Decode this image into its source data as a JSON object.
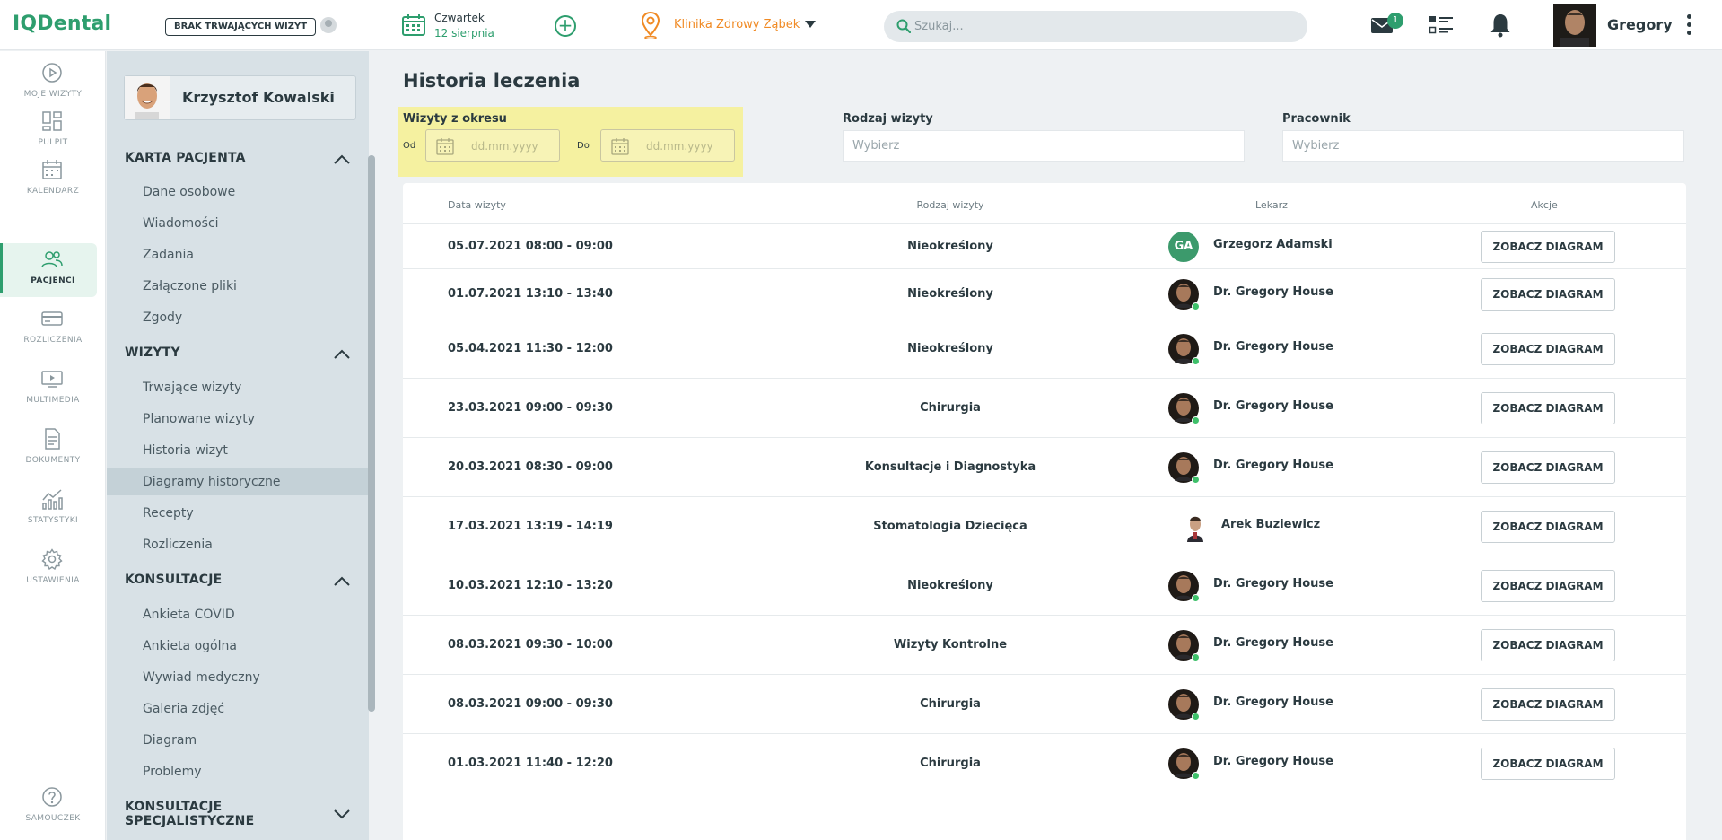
{
  "app": {
    "logo": "IQDental"
  },
  "topbar": {
    "no_visits_label": "BRAK TRWAJĄCYCH WIZYT",
    "day": "Czwartek",
    "date": "12 sierpnia",
    "clinic": "Klinika Zdrowy Ząbek",
    "search_placeholder": "Szukaj...",
    "mail_count": "1",
    "user_name": "Gregory",
    "colors": {
      "accent": "#2e9e6e",
      "clinic": "#f08a24"
    }
  },
  "rail": {
    "items": [
      {
        "label": "MOJE WIZYTY",
        "icon": "play-circle-icon"
      },
      {
        "label": "PULPIT",
        "icon": "dashboard-icon"
      },
      {
        "label": "KALENDARZ",
        "icon": "calendar-icon"
      },
      {
        "label": "PACJENCI",
        "icon": "patients-icon",
        "active": true
      },
      {
        "label": "ROZLICZENIA",
        "icon": "card-icon"
      },
      {
        "label": "MULTIMEDIA",
        "icon": "media-icon"
      },
      {
        "label": "DOKUMENTY",
        "icon": "document-icon"
      },
      {
        "label": "STATYSTYKI",
        "icon": "chart-icon"
      },
      {
        "label": "USTAWIENIA",
        "icon": "gear-icon"
      }
    ],
    "help_label": "SAMOUCZEK"
  },
  "patient": {
    "name": "Krzysztof Kowalski",
    "sections": [
      {
        "title": "KARTA PACJENTA",
        "items": [
          "Dane osobowe",
          "Wiadomości",
          "Zadania",
          "Załączone pliki",
          "Zgody"
        ]
      },
      {
        "title": "WIZYTY",
        "items": [
          "Trwające wizyty",
          "Planowane wizyty",
          "Historia wizyt",
          "Diagramy historyczne",
          "Recepty",
          "Rozliczenia"
        ]
      },
      {
        "title": "KONSULTACJE",
        "items": [
          "Ankieta COVID",
          "Ankieta ogólna",
          "Wywiad medyczny",
          "Galeria zdjęć",
          "Diagram",
          "Problemy"
        ]
      },
      {
        "title_line1": "KONSULTACJE",
        "title_line2": "SPECJALISTYCZNE"
      }
    ],
    "active_item": "Diagramy historyczne"
  },
  "main": {
    "title": "Historia leczenia",
    "period_label": "Wizyty z okresu",
    "from_label": "Od",
    "to_label": "Do",
    "date_placeholder": "dd.mm.yyyy",
    "visit_type_label": "Rodzaj wizyty",
    "visit_type_placeholder": "Wybierz",
    "employee_label": "Pracownik",
    "employee_placeholder": "Wybierz",
    "columns": [
      "Data wizyty",
      "Rodzaj wizyty",
      "Lekarz",
      "Akcje"
    ],
    "action_label": "ZOBACZ DIAGRAM",
    "rows": [
      {
        "date": "05.07.2021 08:00 - 09:00",
        "type": "Nieokreślony",
        "doctor": "Grzegorz Adamski",
        "initials": "GA"
      },
      {
        "date": "01.07.2021 13:10 - 13:40",
        "type": "Nieokreślony",
        "doctor": "Dr. Gregory House"
      },
      {
        "date": "05.04.2021 11:30 - 12:00",
        "type": "Nieokreślony",
        "doctor": "Dr. Gregory House"
      },
      {
        "date": "23.03.2021 09:00 - 09:30",
        "type": "Chirurgia",
        "doctor": "Dr. Gregory House"
      },
      {
        "date": "20.03.2021 08:30 - 09:00",
        "type": "Konsultacje i Diagnostyka",
        "doctor": "Dr. Gregory House"
      },
      {
        "date": "17.03.2021 13:19 - 14:19",
        "type": "Stomatologia Dziecięca",
        "doctor": "Arek Buziewicz"
      },
      {
        "date": "10.03.2021 12:10 - 13:20",
        "type": "Nieokreślony",
        "doctor": "Dr. Gregory House"
      },
      {
        "date": "08.03.2021 09:30 - 10:00",
        "type": "Wizyty Kontrolne",
        "doctor": "Dr. Gregory House"
      },
      {
        "date": "08.03.2021 09:00 - 09:30",
        "type": "Chirurgia",
        "doctor": "Dr. Gregory House"
      },
      {
        "date": "01.03.2021 11:40 - 12:20",
        "type": "Chirurgia",
        "doctor": "Dr. Gregory House"
      }
    ]
  }
}
